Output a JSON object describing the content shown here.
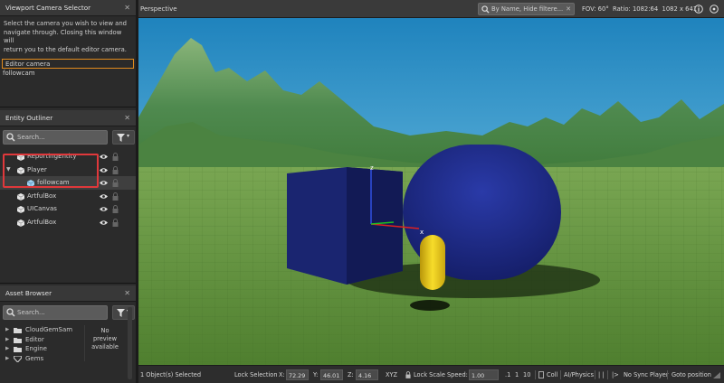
{
  "camera_selector": {
    "title": "Viewport Camera Selector",
    "description_lines": [
      "Select the camera you wish to view and",
      "navigate through.  Closing this window will",
      "return you to the default editor camera."
    ],
    "cameras": [
      "Editor camera",
      "followcam"
    ],
    "selected_index": 0
  },
  "entity_outliner": {
    "title": "Entity Outliner",
    "search_placeholder": "Search...",
    "entities": [
      {
        "label": "ReportingEntity",
        "depth": 0,
        "expandable": false
      },
      {
        "label": "Player",
        "depth": 0,
        "expandable": true
      },
      {
        "label": "followcam",
        "depth": 1,
        "expandable": false
      },
      {
        "label": "ArtfulBox",
        "depth": 0,
        "expandable": false
      },
      {
        "label": "UICanvas",
        "depth": 0,
        "expandable": false
      },
      {
        "label": "ArtfulBox",
        "depth": 0,
        "expandable": false
      }
    ]
  },
  "asset_browser": {
    "title": "Asset Browser",
    "search_placeholder": "Search...",
    "folders": [
      "CloudGemSam",
      "Editor",
      "Engine",
      "Gems"
    ],
    "no_preview_lines": [
      "No",
      "preview",
      "available"
    ]
  },
  "viewport": {
    "title": "Perspective",
    "search_placeholder": "By Name, Hide filtere...",
    "fov_text": "FOV: 60°  Ratio: 1082:64  1082 x 641",
    "axis_labels": {
      "z": "z",
      "x": "x"
    },
    "colors": {
      "sky": "#3f9ec9",
      "ground": "#5c8a3a",
      "box": "#1c2b7a",
      "capsule": "#1d2a8c",
      "yellow_capsule": "#f2d21e",
      "mountains": "#4f8a4f"
    }
  },
  "status_bar": {
    "selected": "1 Object(s) Selected",
    "lock_selection": "Lock Selection",
    "x_label": "X:",
    "x_value": "72.29",
    "y_label": "Y:",
    "y_value": "46.01",
    "z_label": "Z:",
    "z_value": "4.16",
    "xyz_label": "XYZ",
    "lock_scale": "Lock Scale",
    "speed_label": "Speed:",
    "speed_value": "1.00",
    "speed_presets": [
      ".1",
      "1",
      "10"
    ],
    "coll": "Coll",
    "ai_physics": "AI/Physics",
    "pause": "| |",
    "step": "|>",
    "no_sync": "No Sync Player",
    "goto": "Goto position"
  }
}
